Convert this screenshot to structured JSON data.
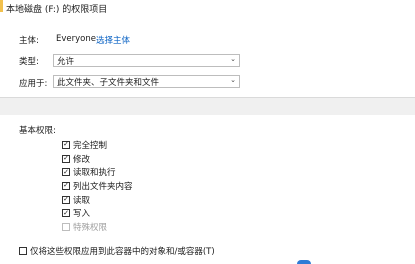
{
  "window": {
    "title": "本地磁盘 (F:) 的权限项目"
  },
  "principal": {
    "label": "主体:",
    "value": "Everyone",
    "select_link": "选择主体"
  },
  "type": {
    "label": "类型:",
    "value": "允许"
  },
  "applies_to": {
    "label": "应用于:",
    "value": "此文件夹、子文件夹和文件"
  },
  "basic_permissions": {
    "heading": "基本权限:",
    "items": [
      {
        "label": "完全控制",
        "checked": true,
        "enabled": true
      },
      {
        "label": "修改",
        "checked": true,
        "enabled": true
      },
      {
        "label": "读取和执行",
        "checked": true,
        "enabled": true
      },
      {
        "label": "列出文件夹内容",
        "checked": true,
        "enabled": true
      },
      {
        "label": "读取",
        "checked": true,
        "enabled": true
      },
      {
        "label": "写入",
        "checked": true,
        "enabled": true
      },
      {
        "label": "特殊权限",
        "checked": false,
        "enabled": false
      }
    ]
  },
  "apply_only_option": {
    "label": "仅将这些权限应用到此容器中的对象和/或容器(T)",
    "checked": false
  },
  "icons": {
    "check": "✓",
    "dropdown": "⌄"
  }
}
